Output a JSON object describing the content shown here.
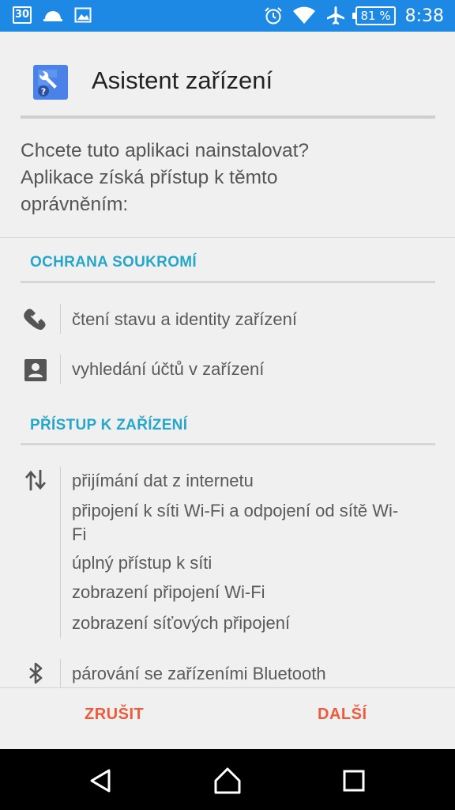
{
  "status_bar": {
    "calendar_day": "30",
    "battery": "81 %",
    "time": "8:38",
    "icons": [
      "calendar-icon",
      "cloud-icon",
      "image-icon",
      "alarm-icon",
      "wifi-icon",
      "airplane-icon",
      "battery-icon"
    ]
  },
  "app": {
    "title": "Asistent zařízení",
    "icon": "device-assistant-icon"
  },
  "prompt": {
    "line1": "Chcete tuto aplikaci nainstalovat?",
    "line2": "Aplikace získá přístup k těmto",
    "line3": "oprávněním:"
  },
  "sections": [
    {
      "title": "OCHRANA SOUKROMÍ",
      "groups": [
        {
          "icon": "phone-icon",
          "items": [
            "čtení stavu a identity zařízení"
          ]
        },
        {
          "icon": "contact-icon",
          "items": [
            "vyhledání účtů v zařízení"
          ]
        }
      ]
    },
    {
      "title": "PŘÍSTUP K ZAŘÍZENÍ",
      "groups": [
        {
          "icon": "data-transfer-icon",
          "items": [
            "přijímání dat z internetu",
            "připojení k síti Wi-Fi a odpojení od sítě Wi-",
            "Fi",
            "úplný přístup k síti",
            "zobrazení připojení Wi-Fi",
            "zobrazení síťových připojení"
          ]
        },
        {
          "icon": "bluetooth-icon",
          "items": [
            "párování se zařízeními Bluetooth"
          ]
        }
      ]
    }
  ],
  "buttons": {
    "cancel": "ZRUŠIT",
    "next": "DALŠÍ"
  },
  "colors": {
    "status_bar": "#1e88e5",
    "section_title": "#26a7c9",
    "button": "#ef5a3a"
  }
}
